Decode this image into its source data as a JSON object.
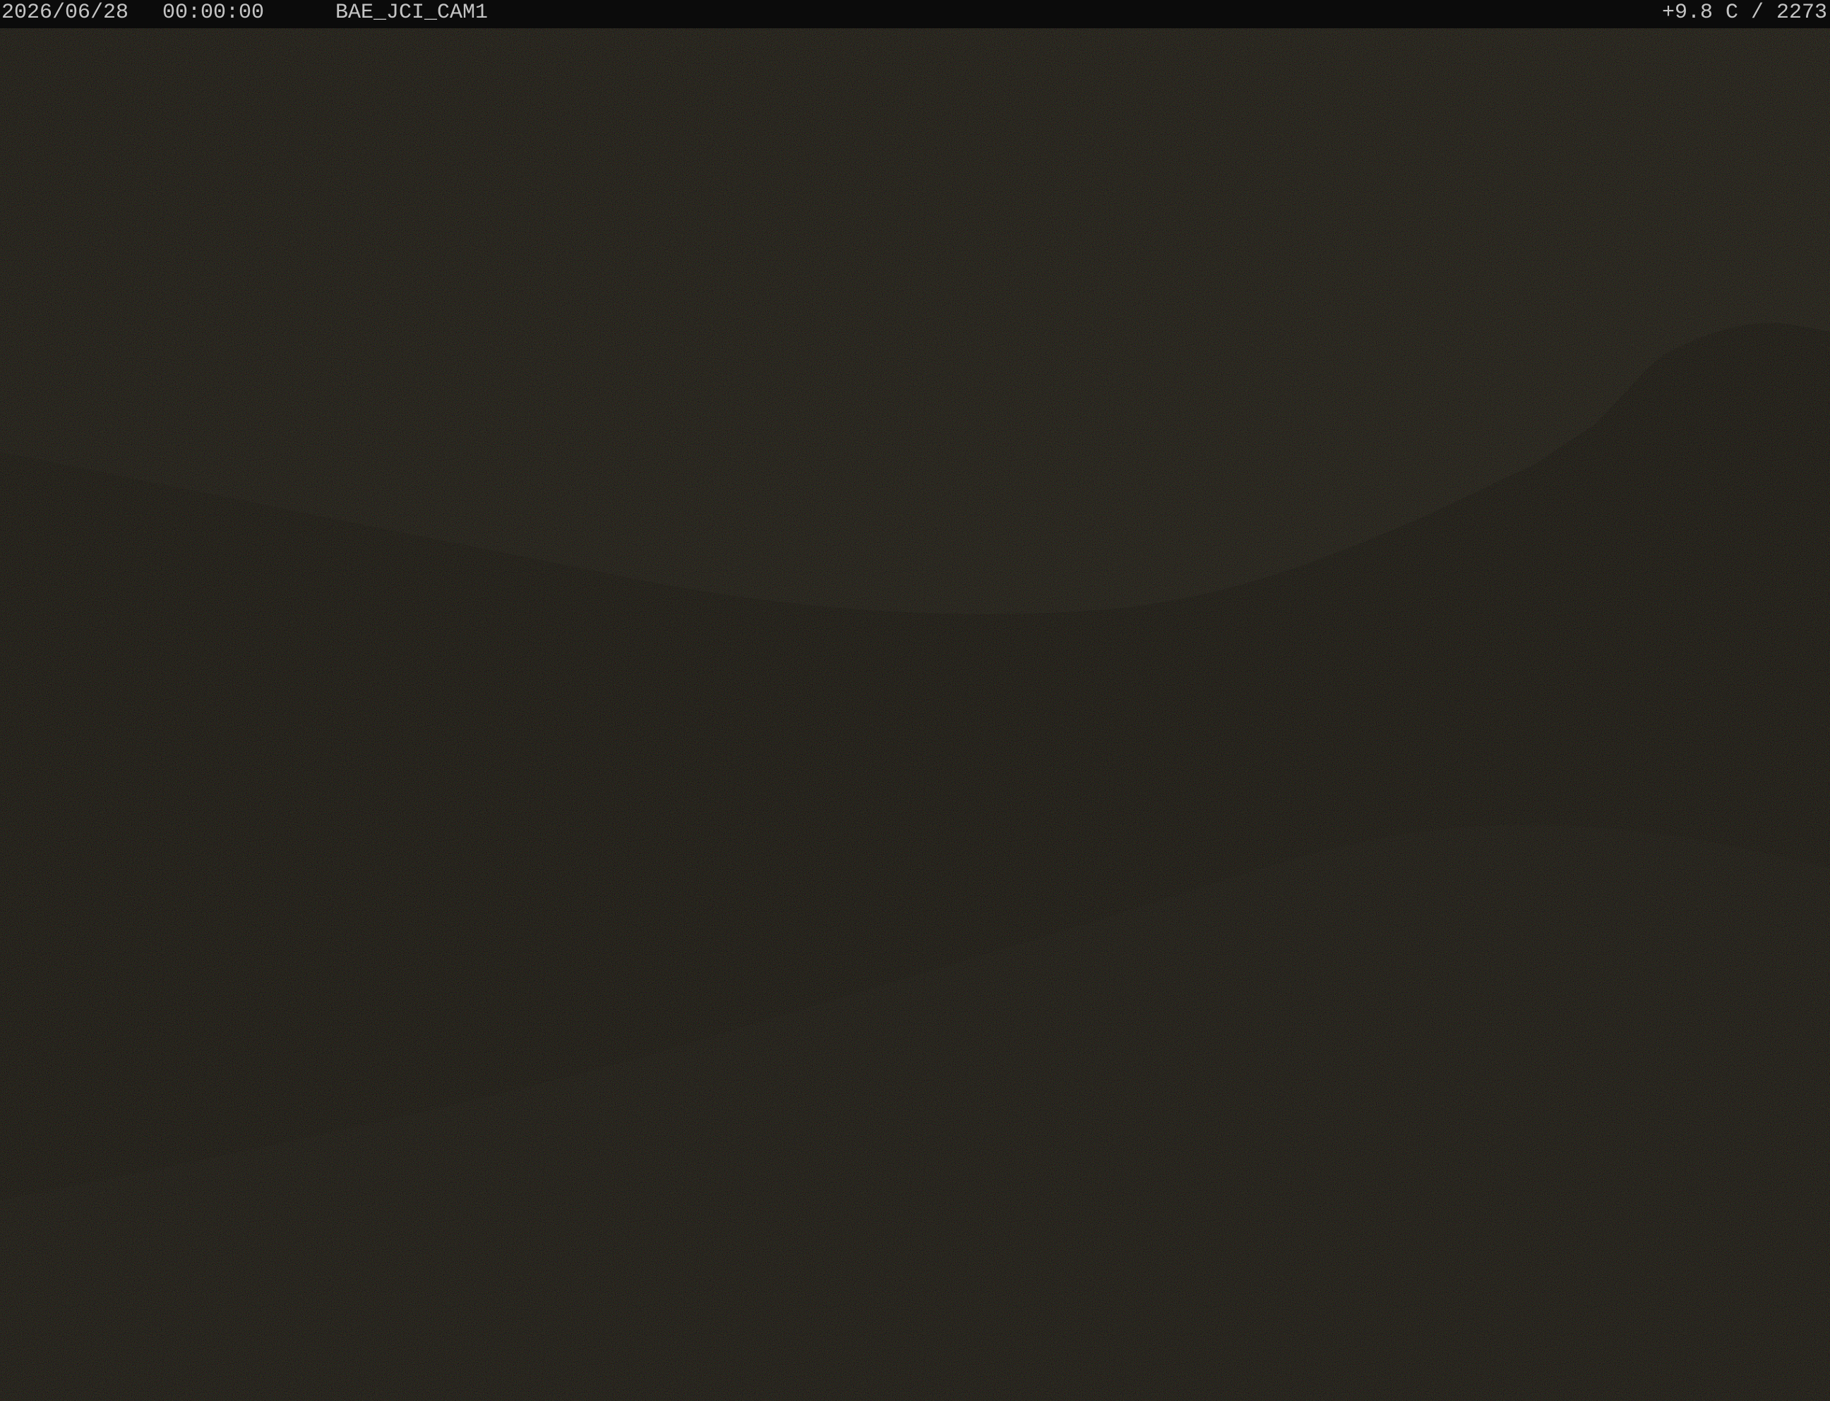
{
  "overlay": {
    "date": "2026/06/28",
    "time": "00:00:00",
    "camera_name": "BAE_JCI_CAM1",
    "readout": "+9.8 C / 2273"
  },
  "scene": {
    "description_colors": {
      "sky": "#151515",
      "foreground": "#111111",
      "osd_text": "#c4c4c4",
      "osd_bar": "#0b0b0b"
    }
  }
}
